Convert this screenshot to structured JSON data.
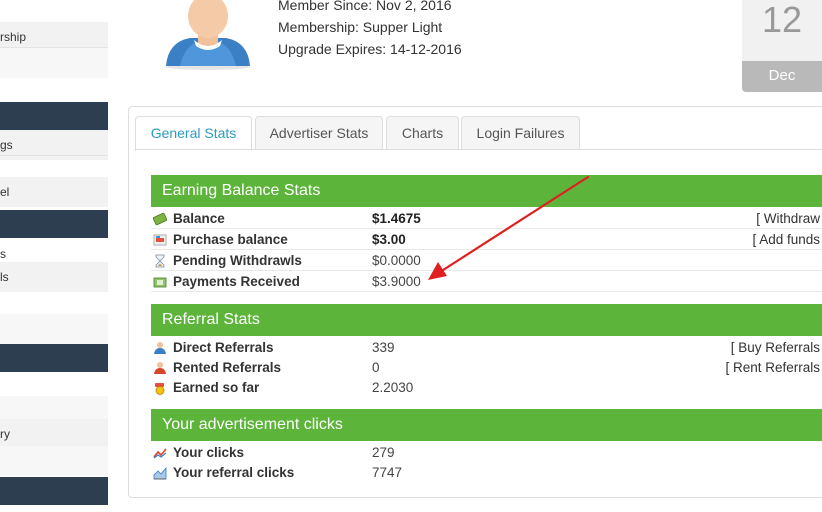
{
  "sidebar": {
    "items": [
      {
        "label": "rship"
      },
      {
        "label": "gs"
      },
      {
        "label": "el"
      },
      {
        "label": "s"
      },
      {
        "label": "ls"
      },
      {
        "label": "ry"
      }
    ]
  },
  "member": {
    "since": "Member Since: Nov 2, 2016",
    "membership": "Membership: Supper Light",
    "upgrade_expires": "Upgrade Expires: 14-12-2016"
  },
  "date": {
    "day": "12",
    "month": "Dec"
  },
  "tabs": [
    {
      "label": "General Stats",
      "active": true
    },
    {
      "label": "Advertiser Stats",
      "active": false
    },
    {
      "label": "Charts",
      "active": false
    },
    {
      "label": "Login Failures",
      "active": false
    }
  ],
  "earning": {
    "title": "Earning Balance Stats",
    "rows": [
      {
        "label": "Balance",
        "value": "$1.4675",
        "action": "[ Withdraw",
        "icon": "money-icon"
      },
      {
        "label": "Purchase balance",
        "value": "$3.00",
        "action": "[ Add funds",
        "icon": "cart-icon"
      },
      {
        "label": "Pending Withdrawls",
        "value": "$0.0000",
        "action": "",
        "icon": "hourglass-icon"
      },
      {
        "label": "Payments Received",
        "value": "$3.9000",
        "action": "",
        "icon": "payment-icon"
      }
    ]
  },
  "referral": {
    "title": "Referral Stats",
    "rows": [
      {
        "label": "Direct Referrals",
        "value": "339",
        "action": "[ Buy Referrals",
        "icon": "user-icon"
      },
      {
        "label": "Rented Referrals",
        "value": "0",
        "action": "[ Rent Referrals",
        "icon": "user-red-icon"
      },
      {
        "label": "Earned so far",
        "value": "2.2030",
        "action": "",
        "icon": "coins-icon"
      }
    ]
  },
  "clicks": {
    "title": "Your advertisement clicks",
    "rows": [
      {
        "label": "Your clicks",
        "value": "279",
        "icon": "chart-line-icon"
      },
      {
        "label": "Your referral clicks",
        "value": "7747",
        "icon": "chart-area-icon"
      }
    ]
  },
  "colors": {
    "section_green": "#5cb53a",
    "sidebar_navy": "#2c3e50",
    "tab_active_text": "#2b9bbf",
    "annotation_arrow": "#e02020"
  }
}
